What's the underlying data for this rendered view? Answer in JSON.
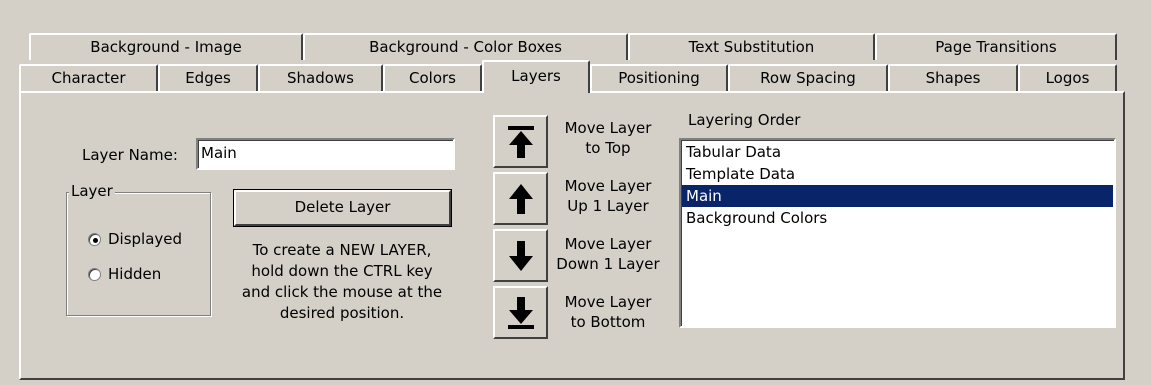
{
  "tabs_row1": [
    {
      "label": "Background - Image"
    },
    {
      "label": "Background - Color Boxes"
    },
    {
      "label": "Text Substitution"
    },
    {
      "label": "Page Transitions"
    }
  ],
  "tabs_row2": [
    {
      "label": "Character"
    },
    {
      "label": "Edges"
    },
    {
      "label": "Shadows"
    },
    {
      "label": "Colors"
    },
    {
      "label": "Layers",
      "active": true
    },
    {
      "label": "Positioning"
    },
    {
      "label": "Row Spacing"
    },
    {
      "label": "Shapes"
    },
    {
      "label": "Logos"
    }
  ],
  "layer_name": {
    "label": "Layer Name:",
    "value": "Main"
  },
  "layer_group": {
    "title": "Layer",
    "options": [
      {
        "label": "Displayed",
        "selected": true
      },
      {
        "label": "Hidden",
        "selected": false
      }
    ]
  },
  "delete_button": {
    "label": "Delete Layer"
  },
  "help_text": [
    "To create a NEW LAYER,",
    "hold down the CTRL key",
    "and click the mouse at the",
    "desired position."
  ],
  "move_buttons": [
    {
      "icon": "arrow-to-top-icon",
      "label_lines": [
        "Move Layer",
        "to Top"
      ]
    },
    {
      "icon": "arrow-up-icon",
      "label_lines": [
        "Move Layer",
        "Up 1 Layer"
      ]
    },
    {
      "icon": "arrow-down-icon",
      "label_lines": [
        "Move Layer",
        "Down 1 Layer"
      ]
    },
    {
      "icon": "arrow-to-bottom-icon",
      "label_lines": [
        "Move Layer",
        "to Bottom"
      ]
    }
  ],
  "layering_order": {
    "title": "Layering Order",
    "items": [
      {
        "label": "Tabular Data",
        "selected": false
      },
      {
        "label": "Template Data",
        "selected": false
      },
      {
        "label": "Main",
        "selected": true
      },
      {
        "label": "Background Colors",
        "selected": false
      }
    ]
  },
  "colors": {
    "face": "#d4d0c8",
    "selection": "#0a246a"
  }
}
